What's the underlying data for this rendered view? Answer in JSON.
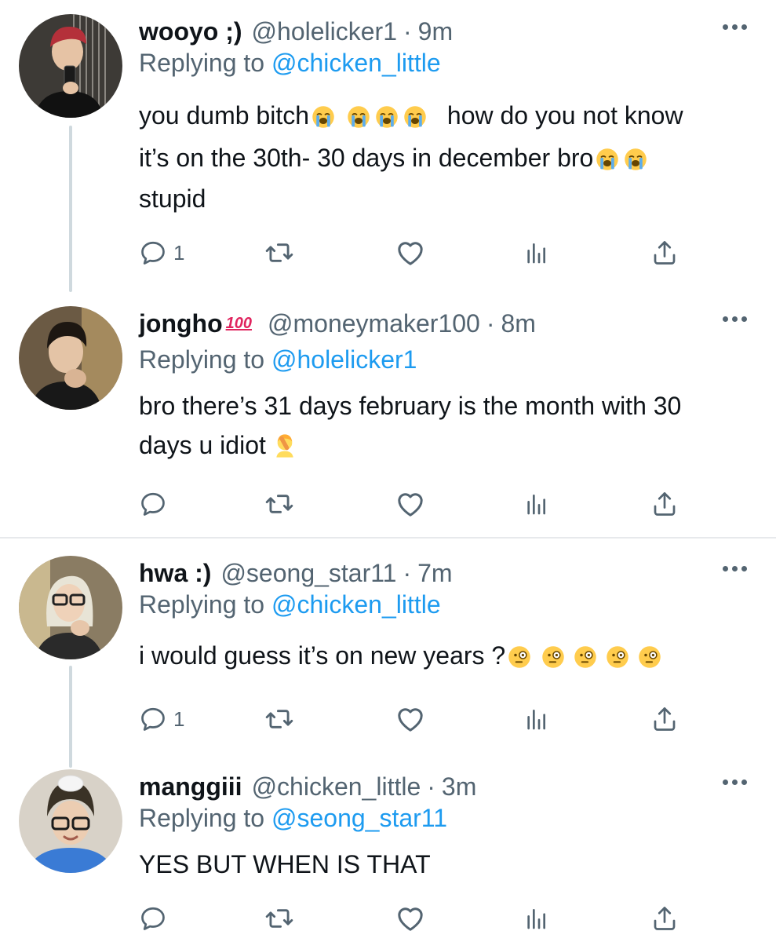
{
  "tweets": [
    {
      "name": "wooyo ;)",
      "handle": "@holelicker1",
      "dot": "·",
      "time": "9m",
      "replying_prefix": "Replying to",
      "replying_to": "@chicken_little",
      "lines": [
        "you dumb bitch",
        "how do you not know",
        "it’s on the 30th- 30 days in december bro",
        "stupid"
      ],
      "reply_count": "1"
    },
    {
      "name": "jongho",
      "name_badge": "100",
      "handle": "@moneymaker100",
      "dot": "·",
      "time": "8m",
      "replying_prefix": "Replying to",
      "replying_to": "@holelicker1",
      "lines": [
        "bro there’s 31 days february is the month with 30",
        "days u idiot"
      ],
      "reply_count": ""
    },
    {
      "name": "hwa :)",
      "handle": "@seong_star11",
      "dot": "·",
      "time": "7m",
      "replying_prefix": "Replying to",
      "replying_to": "@chicken_little",
      "lines": [
        "i would guess it’s on new years ?"
      ],
      "reply_count": "1"
    },
    {
      "name": "manggiii",
      "handle": "@chicken_little",
      "dot": "·",
      "time": "3m",
      "replying_prefix": "Replying to",
      "replying_to": "@seong_star11",
      "lines": [
        "YES BUT WHEN IS THAT"
      ],
      "reply_count": ""
    }
  ],
  "icons": {
    "reply": "reply-icon",
    "retweet": "retweet-icon",
    "like": "heart-icon",
    "views": "analytics-icon",
    "share": "share-icon",
    "more": "more-icon"
  },
  "colors": {
    "link": "#1d9bf0",
    "muted": "#536471",
    "thread_line": "#cfd9de",
    "divider": "#e7e9ec"
  }
}
